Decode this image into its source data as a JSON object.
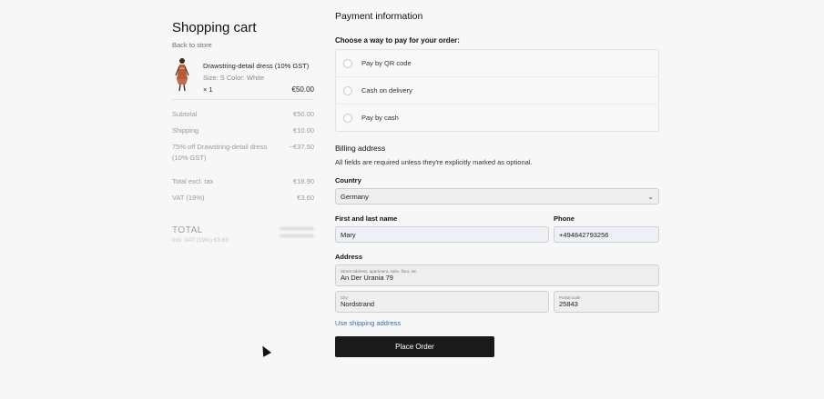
{
  "cart": {
    "title": "Shopping cart",
    "back_link": "Back to store",
    "item": {
      "name": "Drawstring-detail dress (10% GST)",
      "meta": "Size: S  Color: White",
      "qty": "× 1",
      "price": "€50.00"
    },
    "summary": [
      {
        "label": "Subtotal",
        "value": "€50.00"
      },
      {
        "label": "Shipping",
        "value": "€10.00"
      },
      {
        "label": "75% off Drawstring-detail dress (10% GST)",
        "value": "−€37.50"
      },
      {
        "label": "Total excl. tax",
        "value": "€18.90"
      },
      {
        "label": "VAT (19%)",
        "value": "€3.60"
      }
    ],
    "total_label": "TOTAL",
    "total_sub": "incl. VAT (19%) €3.60"
  },
  "payment": {
    "title": "Payment information",
    "prompt": "Choose a way to pay for your order:",
    "options": [
      {
        "label": "Pay by QR code"
      },
      {
        "label": "Cash on delivery"
      },
      {
        "label": "Pay by cash"
      }
    ]
  },
  "billing": {
    "title": "Billing address",
    "note": "All fields are required unless they're explicitly marked as optional.",
    "country_label": "Country",
    "country_value": "Germany",
    "name_label": "First and last name",
    "name_value": "Mary",
    "phone_label": "Phone",
    "phone_value": "+494842793256",
    "address_label": "Address",
    "street_hint": "Street address, apartment, suite, floor, etc",
    "street_value": "An Der Urania 79",
    "city_hint": "City",
    "city_value": "Nordstrand",
    "postal_hint": "Postal code",
    "postal_value": "25843",
    "use_shipping": "Use shipping address",
    "submit": "Place Order"
  }
}
